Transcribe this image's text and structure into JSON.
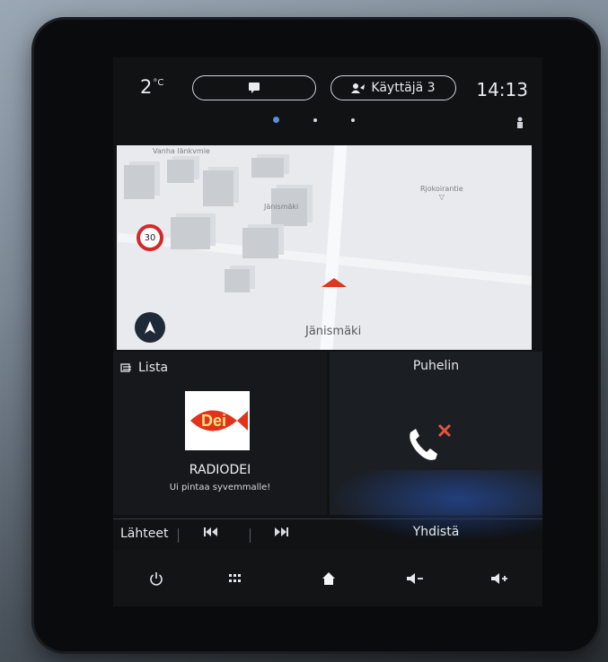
{
  "status": {
    "temperature": "2",
    "temperature_unit": "°C",
    "user_label": "Käyttäjä 3",
    "time": "14:13"
  },
  "pager": {
    "count": 3,
    "active": 1
  },
  "map": {
    "speed_limit": "30",
    "place_main": "Jänismäki",
    "label_top_left": "Vanha länkvmie",
    "label_right": "Rjokoirantie",
    "label_center": "Jänismäki"
  },
  "media": {
    "header_label": "Lista",
    "station_name": "RADIODEI",
    "slogan": "Ui pintaa syvemmalle!",
    "logo_text": "Dei"
  },
  "phone": {
    "header_label": "Puhelin",
    "connect_label": "Yhdistä"
  },
  "controls": {
    "sources_label": "Lähteet"
  },
  "colors": {
    "accent": "#5b8fd6",
    "red": "#d9391f",
    "phone_x": "#e0553f"
  },
  "icons": {
    "message": "message-icon",
    "user": "user-icon",
    "power": "power-icon",
    "apps": "apps-grid-icon",
    "home": "home-icon",
    "vol_down": "volume-down-icon",
    "vol_up": "volume-up-icon",
    "prev": "previous-track-icon",
    "next": "next-track-icon",
    "phone": "phone-disconnected-icon",
    "compass": "compass-icon"
  }
}
